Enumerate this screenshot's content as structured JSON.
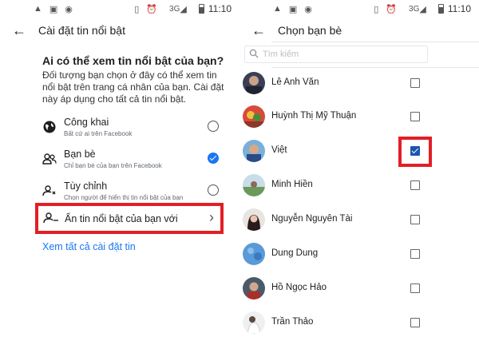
{
  "status": {
    "signal": "3G",
    "time": "11:10"
  },
  "left": {
    "title": "Cài đặt tin nổi bật",
    "heading": "Ai có thể xem tin nổi bật của bạn?",
    "description": "Đối tượng bạn chọn ở đây có thể xem tin nổi bật trên trang cá nhân của bạn. Cài đặt này áp dụng cho tất cả tin nổi bật.",
    "options": [
      {
        "title": "Công khai",
        "subtitle": "Bất cứ ai trên Facebook",
        "icon": "globe-icon",
        "selected": false
      },
      {
        "title": "Bạn bè",
        "subtitle": "Chỉ bạn bè của bạn trên Facebook",
        "icon": "friends-icon",
        "selected": true
      },
      {
        "title": "Tùy chỉnh",
        "subtitle": "Chọn người để hiển thị tin nổi bật của bạn",
        "icon": "custom-person-icon",
        "selected": false
      }
    ],
    "hide_row": {
      "title": "Ẩn tin nổi bật của bạn  với",
      "icon": "hide-person-icon"
    },
    "see_all_link": "Xem tất cả cài đặt tin"
  },
  "right": {
    "title": "Chọn bạn bè",
    "search_placeholder": "Tìm kiếm",
    "friends": [
      {
        "name": "Lê Anh Văn",
        "checked": false
      },
      {
        "name": "Huỳnh Thị Mỹ Thuận",
        "checked": false
      },
      {
        "name": "Việt",
        "checked": true
      },
      {
        "name": "Minh Hiền",
        "checked": false
      },
      {
        "name": "Nguyễn Nguyên Tài",
        "checked": false
      },
      {
        "name": "Dung Dung",
        "checked": false
      },
      {
        "name": "Hồ Ngọc Hảo",
        "checked": false
      },
      {
        "name": "Trần Thảo",
        "checked": false
      }
    ]
  },
  "colors": {
    "accent": "#1877f2",
    "highlight": "#e21f26",
    "checkbox": "#1a56b0"
  }
}
